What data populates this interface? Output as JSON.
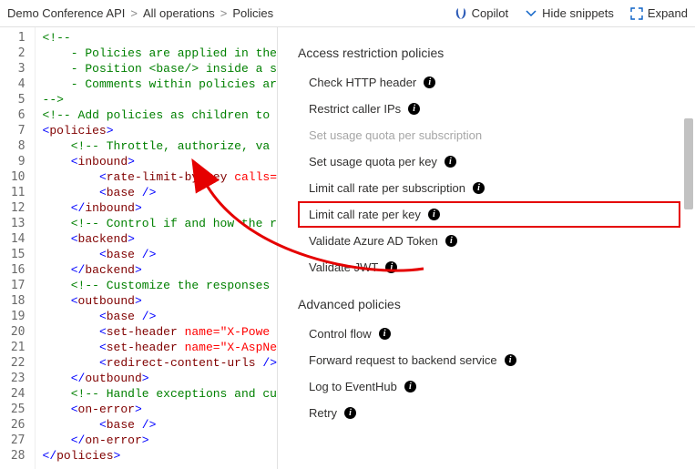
{
  "breadcrumb": {
    "items": [
      "Demo Conference API",
      "All operations",
      "Policies"
    ]
  },
  "toolbar": {
    "copilot": "Copilot",
    "hide_snippets": "Hide snippets",
    "expand": "Expand"
  },
  "code": {
    "lines": [
      {
        "n": 1,
        "cls": "c-comment",
        "indent": 0,
        "text": "<!--"
      },
      {
        "n": 2,
        "cls": "c-comment",
        "indent": 1,
        "text": "- Policies are applied in the"
      },
      {
        "n": 3,
        "cls": "c-comment",
        "indent": 1,
        "text": "- Position <base/> inside a s"
      },
      {
        "n": 4,
        "cls": "c-comment",
        "indent": 1,
        "text": "- Comments within policies ar"
      },
      {
        "n": 5,
        "cls": "c-comment",
        "indent": 0,
        "text": "-->"
      },
      {
        "n": 6,
        "cls": "c-comment",
        "indent": 0,
        "text": "<!-- Add policies as children to "
      },
      {
        "n": 7,
        "cls": "tag",
        "indent": 0,
        "tag": "policies",
        "open": true
      },
      {
        "n": 8,
        "cls": "c-comment",
        "indent": 1,
        "text": "<!-- Throttle, authorize, va"
      },
      {
        "n": 9,
        "cls": "tag",
        "indent": 1,
        "tag": "inbound",
        "open": true
      },
      {
        "n": 10,
        "cls": "tag-attr",
        "indent": 2,
        "tag": "rate-limit-by-key",
        "attr": "calls="
      },
      {
        "n": 11,
        "cls": "self",
        "indent": 2,
        "tag": "base"
      },
      {
        "n": 12,
        "cls": "tag",
        "indent": 1,
        "tag": "inbound",
        "open": false
      },
      {
        "n": 13,
        "cls": "c-comment",
        "indent": 1,
        "text": "<!-- Control if and how the r"
      },
      {
        "n": 14,
        "cls": "tag",
        "indent": 1,
        "tag": "backend",
        "open": true
      },
      {
        "n": 15,
        "cls": "self",
        "indent": 2,
        "tag": "base"
      },
      {
        "n": 16,
        "cls": "tag",
        "indent": 1,
        "tag": "backend",
        "open": false
      },
      {
        "n": 17,
        "cls": "c-comment",
        "indent": 1,
        "text": "<!-- Customize the responses"
      },
      {
        "n": 18,
        "cls": "tag",
        "indent": 1,
        "tag": "outbound",
        "open": true
      },
      {
        "n": 19,
        "cls": "self",
        "indent": 2,
        "tag": "base"
      },
      {
        "n": 20,
        "cls": "tag-attr",
        "indent": 2,
        "tag": "set-header",
        "attr": "name=\"X-Powe"
      },
      {
        "n": 21,
        "cls": "tag-attr",
        "indent": 2,
        "tag": "set-header",
        "attr": "name=\"X-AspNe"
      },
      {
        "n": 22,
        "cls": "self-attr",
        "indent": 2,
        "tag": "redirect-content-urls",
        "attr": "/>"
      },
      {
        "n": 23,
        "cls": "tag",
        "indent": 1,
        "tag": "outbound",
        "open": false
      },
      {
        "n": 24,
        "cls": "c-comment",
        "indent": 1,
        "text": "<!-- Handle exceptions and cu"
      },
      {
        "n": 25,
        "cls": "tag",
        "indent": 1,
        "tag": "on-error",
        "open": true
      },
      {
        "n": 26,
        "cls": "self",
        "indent": 2,
        "tag": "base"
      },
      {
        "n": 27,
        "cls": "tag",
        "indent": 1,
        "tag": "on-error",
        "open": false
      },
      {
        "n": 28,
        "cls": "tag",
        "indent": 0,
        "tag": "policies",
        "open": false
      }
    ]
  },
  "sidebar": {
    "section1_title": "Access restriction policies",
    "section2_title": "Advanced policies",
    "access": [
      {
        "label": "Check HTTP header",
        "disabled": false,
        "highlight": false
      },
      {
        "label": "Restrict caller IPs",
        "disabled": false,
        "highlight": false
      },
      {
        "label": "Set usage quota per subscription",
        "disabled": true,
        "highlight": false
      },
      {
        "label": "Set usage quota per key",
        "disabled": false,
        "highlight": false
      },
      {
        "label": "Limit call rate per subscription",
        "disabled": false,
        "highlight": false
      },
      {
        "label": "Limit call rate per key",
        "disabled": false,
        "highlight": true
      },
      {
        "label": "Validate Azure AD Token",
        "disabled": false,
        "highlight": false
      },
      {
        "label": "Validate JWT",
        "disabled": false,
        "highlight": false
      }
    ],
    "advanced": [
      {
        "label": "Control flow"
      },
      {
        "label": "Forward request to backend service"
      },
      {
        "label": "Log to EventHub"
      },
      {
        "label": "Retry"
      }
    ]
  }
}
